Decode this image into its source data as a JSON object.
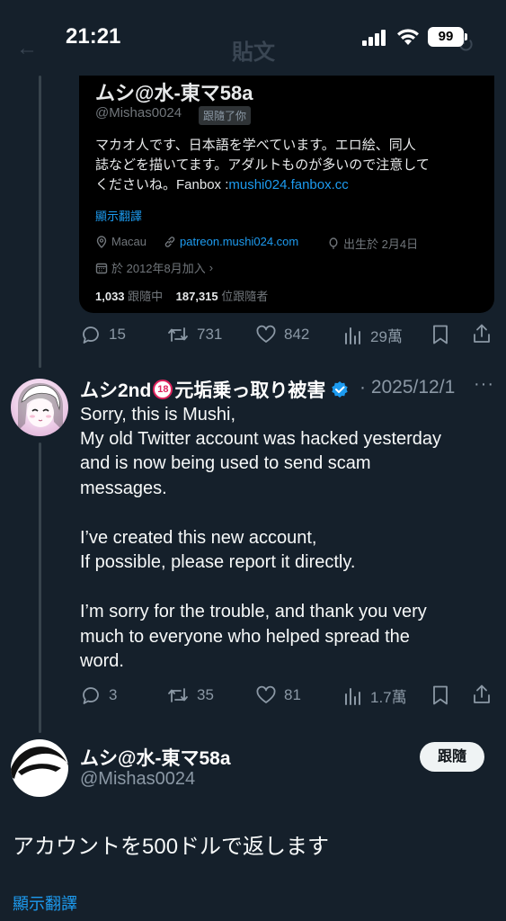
{
  "status_bar": {
    "time": "21:21",
    "battery": "99"
  },
  "header": {
    "title": "貼文"
  },
  "quote": {
    "name": "ムシ@水-東マ58a",
    "handle": "@Mishas0024",
    "follows_you": "跟隨了你",
    "bio_line1": "マカオ人です、日本語を学べています。エロ絵、同人",
    "bio_line2": "誌などを描いてます。アダルトものが多いので注意して",
    "bio_line3_prefix": "くださいね。Fanbox :",
    "bio_link": "mushi024.fanbox.cc",
    "translate": "顯示翻譯",
    "location": "Macau",
    "website": "patreon.mushi024.com",
    "birthday": "出生於 2月4日",
    "joined": "於 2012年8月加入",
    "following_count": "1,033",
    "following_label": "跟隨中",
    "followers_count": "187,315",
    "followers_label": "位跟隨者"
  },
  "tweet1_actions": {
    "replies": "15",
    "retweets": "731",
    "likes": "842",
    "views": "29萬"
  },
  "tweet2": {
    "name_part1": "ムシ2nd",
    "badge": "18",
    "name_part2": "元垢乗っ取り被害",
    "date": "· 2025/12/1",
    "lines": [
      "Sorry, this is Mushi,",
      "My old Twitter account was hacked yesterday",
      "and is now being used to send scam",
      "messages.",
      "I’ve created this new account,",
      "If possible, please report it directly.",
      "I’m sorry for the trouble, and thank you very",
      "much to everyone who helped spread the",
      "word."
    ],
    "actions": {
      "replies": "3",
      "retweets": "35",
      "likes": "81",
      "views": "1.7萬"
    }
  },
  "tweet3": {
    "name": "ムシ@水-東マ58a",
    "handle": "@Mishas0024",
    "follow": "跟隨",
    "text": "アカウントを500ドルで返します",
    "translate": "顯示翻譯"
  }
}
